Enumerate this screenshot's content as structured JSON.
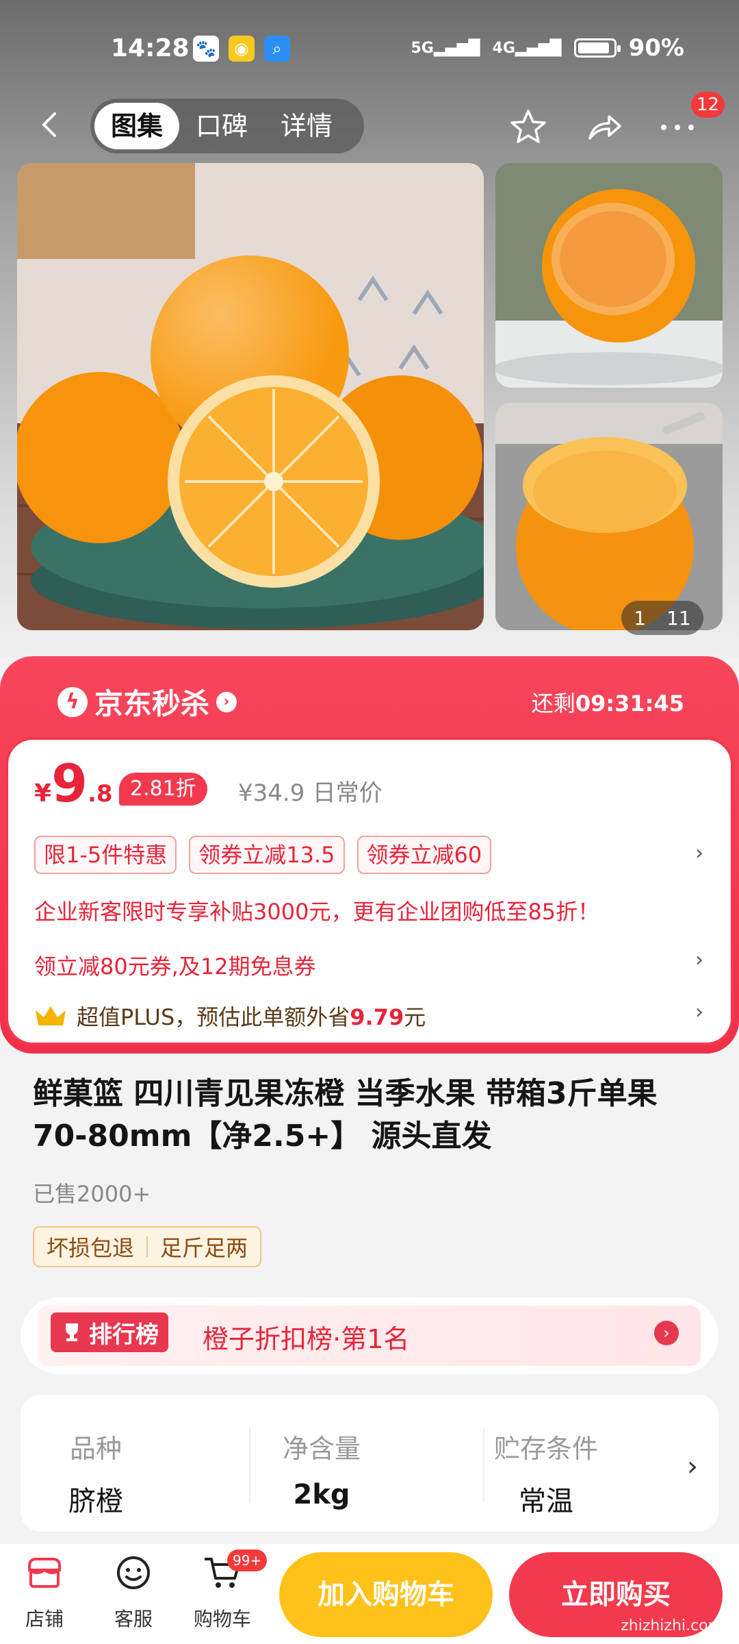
{
  "status": {
    "time": "14:28",
    "net1": "5G",
    "net2": "4G",
    "battery": "90%",
    "battery_level": 0.9
  },
  "nav": {
    "tabs": [
      "图集",
      "口碑",
      "详情"
    ],
    "active_tab": 0,
    "more_badge": "12"
  },
  "gallery": {
    "current": "1",
    "total": "11"
  },
  "flash": {
    "brand": "京东秒杀",
    "countdown_label": "还剩",
    "countdown": "09:31:45",
    "currency": "¥",
    "price_int": "9",
    "price_dec": ".8",
    "discount": "2.81折",
    "orig_price": "¥34.9",
    "orig_label": "日常价",
    "coupons": [
      "限1-5件特惠",
      "领券立减13.5",
      "领券立减60"
    ],
    "promo": "企业新客限时专享补贴3000元，更有企业团购低至85折！",
    "promo2": "领立减80元券,及12期免息券",
    "plus_prefix": "超值PLUS，预估此单额外省",
    "plus_amount": "9.79",
    "plus_suffix": "元"
  },
  "product": {
    "title": "鲜菓篮 四川青见果冻橙 当季水果 带箱3斤单果70-80mm【净2.5+】 源头直发",
    "sold": "已售2000+",
    "tags": [
      "坏损包退",
      "足斤足两"
    ]
  },
  "rank": {
    "badge": "排行榜",
    "text": "橙子折扣榜·第1名"
  },
  "specs": [
    {
      "label": "品种",
      "value": "脐橙"
    },
    {
      "label": "净含量",
      "value": "2kg"
    },
    {
      "label": "贮存条件",
      "value": "常温"
    }
  ],
  "bottom": {
    "store": "店铺",
    "service": "客服",
    "cart": "购物车",
    "cart_badge": "99+",
    "add_cart": "加入购物车",
    "buy_now": "立即购买",
    "watermark": "zhizhizhi.com"
  },
  "colors": {
    "accent": "#f3394d",
    "yellow": "#ffc21a"
  }
}
